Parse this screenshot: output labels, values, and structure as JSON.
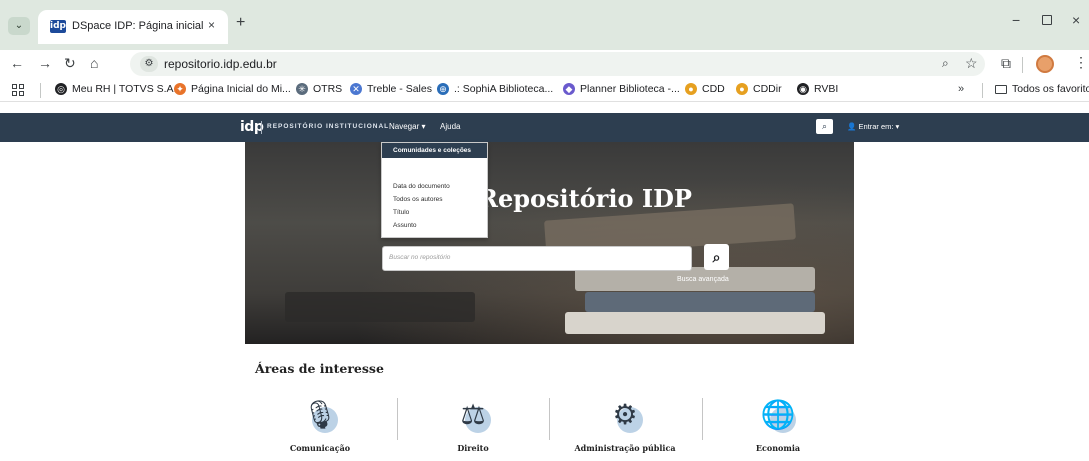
{
  "browser": {
    "tab_title": "DSpace IDP: Página inicial",
    "tab_close": "×",
    "new_tab": "+",
    "url": "repositorio.idp.edu.br",
    "window_controls": {
      "minimize": "−",
      "close": "×"
    }
  },
  "bookmarks": {
    "items": [
      {
        "label": "Meu RH | TOTVS S.A.",
        "icon": "totvs-icon",
        "color": "#202124"
      },
      {
        "label": "Página Inicial do Mi...",
        "icon": "pinwheel-icon",
        "color": "#e8732a"
      },
      {
        "label": "OTRS",
        "icon": "otrs-icon",
        "color": "#5a6b7c"
      },
      {
        "label": "Treble - Sales",
        "icon": "treble-icon",
        "color": "#4b77d1"
      },
      {
        "label": ".: SophiA Biblioteca...",
        "icon": "sophia-icon",
        "color": "#2a6db8"
      },
      {
        "label": "Planner Biblioteca -...",
        "icon": "planner-icon",
        "color": "#6a5acd"
      },
      {
        "label": "CDD",
        "icon": "cdd-icon",
        "color": "#e6a020"
      },
      {
        "label": "CDDir",
        "icon": "cddir-icon",
        "color": "#e6a020"
      },
      {
        "label": "RVBI",
        "icon": "rvbi-icon",
        "color": "#202124"
      }
    ],
    "more": "»",
    "all_bookmarks": "Todos os favoritos"
  },
  "navbar": {
    "logo": "idp",
    "repo_name": "REPOSITÓRIO INSTITUCIONAL",
    "browse": "Navegar ▾",
    "help": "Ajuda",
    "login": "Entrar em: ▾"
  },
  "dropdown": {
    "header": "Comunidades e coleções",
    "items": [
      "Data do documento",
      "Todos os autores",
      "Título",
      "Assunto"
    ]
  },
  "hero": {
    "title": "Repositório IDP",
    "search_placeholder": "Buscar no repositório",
    "advanced_search": "Busca avançada"
  },
  "areas": {
    "title": "Áreas de interesse",
    "items": [
      {
        "label": "Comunicação",
        "icon": "microphone-icon"
      },
      {
        "label": "Direito",
        "icon": "gavel-icon"
      },
      {
        "label": "Administração pública",
        "icon": "team-gears-icon"
      },
      {
        "label": "Economia",
        "icon": "globe-chart-icon"
      }
    ]
  },
  "colors": {
    "navbar": "#2d3e50",
    "tabstrip": "#dfe8e0",
    "icon_circle": "#bcd2e6"
  }
}
